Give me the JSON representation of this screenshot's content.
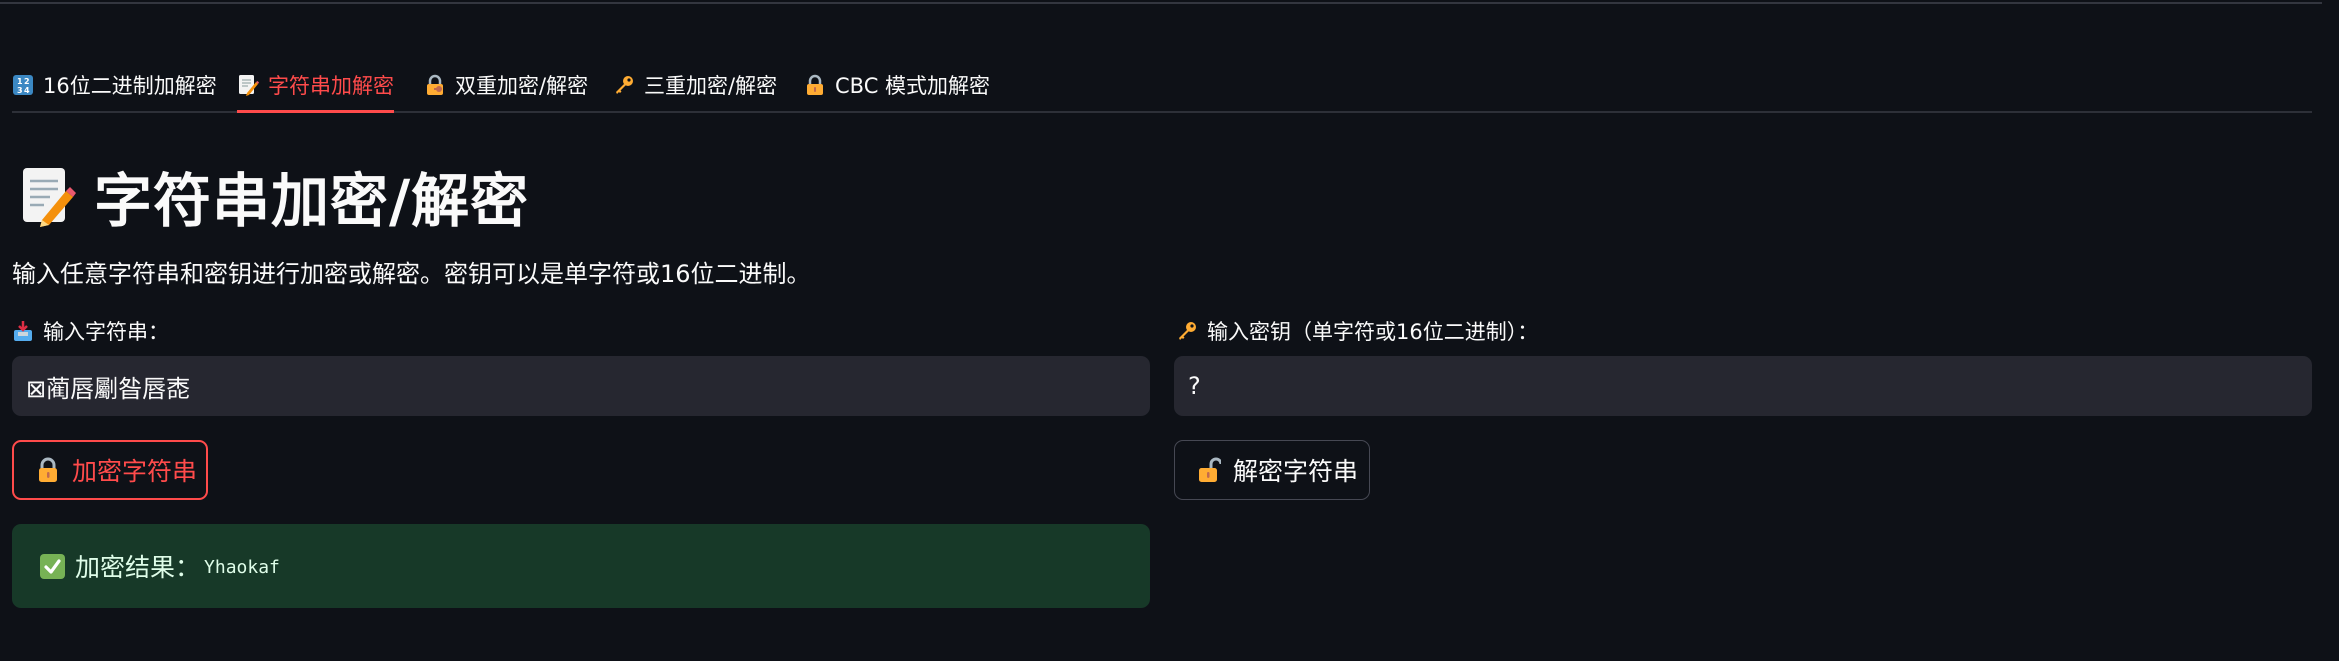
{
  "tabs": [
    {
      "label": "16位二进制加解密",
      "icon": "numbers-icon",
      "active": false
    },
    {
      "label": "字符串加解密",
      "icon": "memo-icon",
      "active": true
    },
    {
      "label": "双重加密/解密",
      "icon": "lock-with-key-icon",
      "active": false
    },
    {
      "label": "三重加密/解密",
      "icon": "key-icon",
      "active": false
    },
    {
      "label": "CBC 模式加解密",
      "icon": "lock-icon",
      "active": false
    }
  ],
  "page": {
    "title": "字符串加密/解密",
    "title_icon": "memo-icon",
    "description": "输入任意字符串和密钥进行加密或解密。密钥可以是单字符或16位二进制。"
  },
  "string_field": {
    "label": "输入字符串：",
    "icon": "inbox-tray-icon",
    "value": "⊠蔺唇劚昝唇唜"
  },
  "key_field": {
    "label": "输入密钥（单字符或16位二进制）：",
    "icon": "key-icon",
    "value": "?"
  },
  "buttons": {
    "encrypt": {
      "label": "加密字符串",
      "icon": "lock-icon"
    },
    "decrypt": {
      "label": "解密字符串",
      "icon": "unlock-icon"
    }
  },
  "result": {
    "label": "加密结果：",
    "value": "Yhaokaf",
    "icon": "check-mark-icon"
  },
  "colors": {
    "background": "#0e1117",
    "accent": "#ff4b4b",
    "input_bg": "#262730",
    "success_bg": "#173928",
    "success_text": "#dffde9"
  }
}
